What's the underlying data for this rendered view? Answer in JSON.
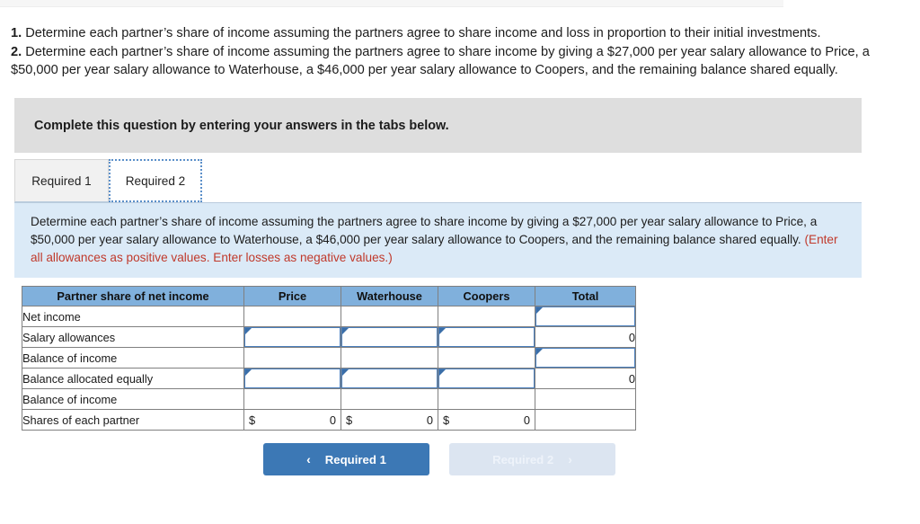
{
  "questions": [
    {
      "number": "1.",
      "text": " Determine each partner’s share of income assuming the partners agree to share income and loss in proportion to their initial investments."
    },
    {
      "number": "2.",
      "text": " Determine each partner’s share of income assuming the partners agree to share income by giving a $27,000 per year salary allowance to Price, a $50,000 per year salary allowance to Waterhouse, a $46,000 per year salary allowance to Coopers, and the remaining balance shared equally."
    }
  ],
  "banner": {
    "text": "Complete this question by entering your answers in the tabs below."
  },
  "tabs": [
    {
      "label": "Required 1",
      "active": false
    },
    {
      "label": "Required 2",
      "active": true
    }
  ],
  "instruction": {
    "main": "Determine each partner’s share of income assuming the partners agree to share income by giving a $27,000 per year salary allowance to Price, a $50,000 per year salary allowance to Waterhouse, a $46,000 per year salary allowance to Coopers, and the remaining balance shared equally. ",
    "note": "(Enter all allowances as positive values. Enter losses as negative values.)"
  },
  "table": {
    "headers": [
      "Partner share of net income",
      "Price",
      "Waterhouse",
      "Coopers",
      "Total"
    ],
    "rows": [
      {
        "label": "Net income",
        "price": {
          "type": "blank",
          "value": ""
        },
        "waterhouse": {
          "type": "blank",
          "value": ""
        },
        "coopers": {
          "type": "blank",
          "value": ""
        },
        "total": {
          "type": "input",
          "value": ""
        }
      },
      {
        "label": "Salary allowances",
        "price": {
          "type": "input",
          "value": ""
        },
        "waterhouse": {
          "type": "input",
          "value": ""
        },
        "coopers": {
          "type": "input",
          "value": ""
        },
        "total": {
          "type": "ruled",
          "value": "0"
        }
      },
      {
        "label": "Balance of income",
        "price": {
          "type": "blank",
          "value": ""
        },
        "waterhouse": {
          "type": "blank",
          "value": ""
        },
        "coopers": {
          "type": "blank",
          "value": ""
        },
        "total": {
          "type": "input",
          "value": ""
        }
      },
      {
        "label": "Balance allocated equally",
        "price": {
          "type": "input",
          "value": ""
        },
        "waterhouse": {
          "type": "input",
          "value": ""
        },
        "coopers": {
          "type": "input",
          "value": ""
        },
        "total": {
          "type": "ruled",
          "value": "0"
        }
      },
      {
        "label": "Balance of income",
        "price": {
          "type": "blank",
          "value": ""
        },
        "waterhouse": {
          "type": "blank",
          "value": ""
        },
        "coopers": {
          "type": "blank",
          "value": ""
        },
        "total": {
          "type": "blank",
          "value": ""
        }
      },
      {
        "label": "Shares of each partner",
        "price": {
          "type": "money",
          "currency": "$",
          "value": "0"
        },
        "waterhouse": {
          "type": "money",
          "currency": "$",
          "value": "0"
        },
        "coopers": {
          "type": "money",
          "currency": "$",
          "value": "0"
        },
        "total": {
          "type": "blank",
          "value": ""
        }
      }
    ]
  },
  "nav": {
    "prev": {
      "label": "Required 1",
      "chevron": "‹",
      "enabled": true
    },
    "next": {
      "label": "Required 2",
      "chevron": "›",
      "enabled": false
    }
  },
  "colors": {
    "header_blue": "#80b0dc",
    "panel_blue": "#dbeaf7",
    "banner_gray": "#dedede",
    "note_red": "#c0392b",
    "button_blue": "#3c78b5",
    "button_disabled": "#dce5f1",
    "input_border": "#4a7fbd"
  }
}
